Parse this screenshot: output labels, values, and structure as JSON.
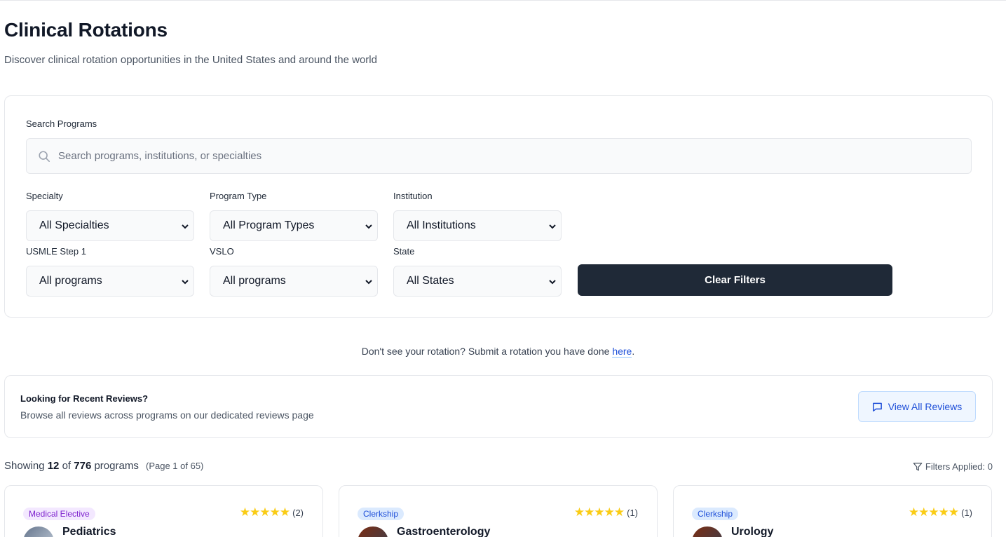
{
  "page": {
    "title": "Clinical Rotations",
    "subtitle": "Discover clinical rotation opportunities in the United States and around the world"
  },
  "search": {
    "label": "Search Programs",
    "placeholder": "Search programs, institutions, or specialties",
    "value": ""
  },
  "filters": {
    "specialty": {
      "label": "Specialty",
      "value": "All Specialties"
    },
    "program_type": {
      "label": "Program Type",
      "value": "All Program Types"
    },
    "institution": {
      "label": "Institution",
      "value": "All Institutions"
    },
    "usmle": {
      "label": "USMLE Step 1",
      "value": "All programs"
    },
    "vslo": {
      "label": "VSLO",
      "value": "All programs"
    },
    "state": {
      "label": "State",
      "value": "All States"
    },
    "clear_label": "Clear Filters"
  },
  "submit_note": {
    "text": "Don't see your rotation? Submit a rotation you have done ",
    "link": "here",
    "suffix": "."
  },
  "reviews_banner": {
    "title": "Looking for Recent Reviews?",
    "description": "Browse all reviews across programs on our dedicated reviews page",
    "button": "View All Reviews"
  },
  "results": {
    "prefix": "Showing",
    "shown": "12",
    "of": "of",
    "total": "776",
    "suffix": "programs",
    "page_info": "(Page 1 of 65)",
    "filters_applied": "Filters Applied: 0"
  },
  "programs": [
    {
      "badge": "Medical Elective",
      "stars": "★★★★★",
      "count": "(2)",
      "name": "Pediatrics"
    },
    {
      "badge": "Clerkship",
      "stars": "★★★★★",
      "count": "(1)",
      "name": "Gastroenterology"
    },
    {
      "badge": "Clerkship",
      "stars": "★★★★★",
      "count": "(1)",
      "name": "Urology"
    }
  ],
  "colors": {
    "primary_button": "#1f2937",
    "link": "#1d4ed8",
    "star": "#facc15"
  }
}
